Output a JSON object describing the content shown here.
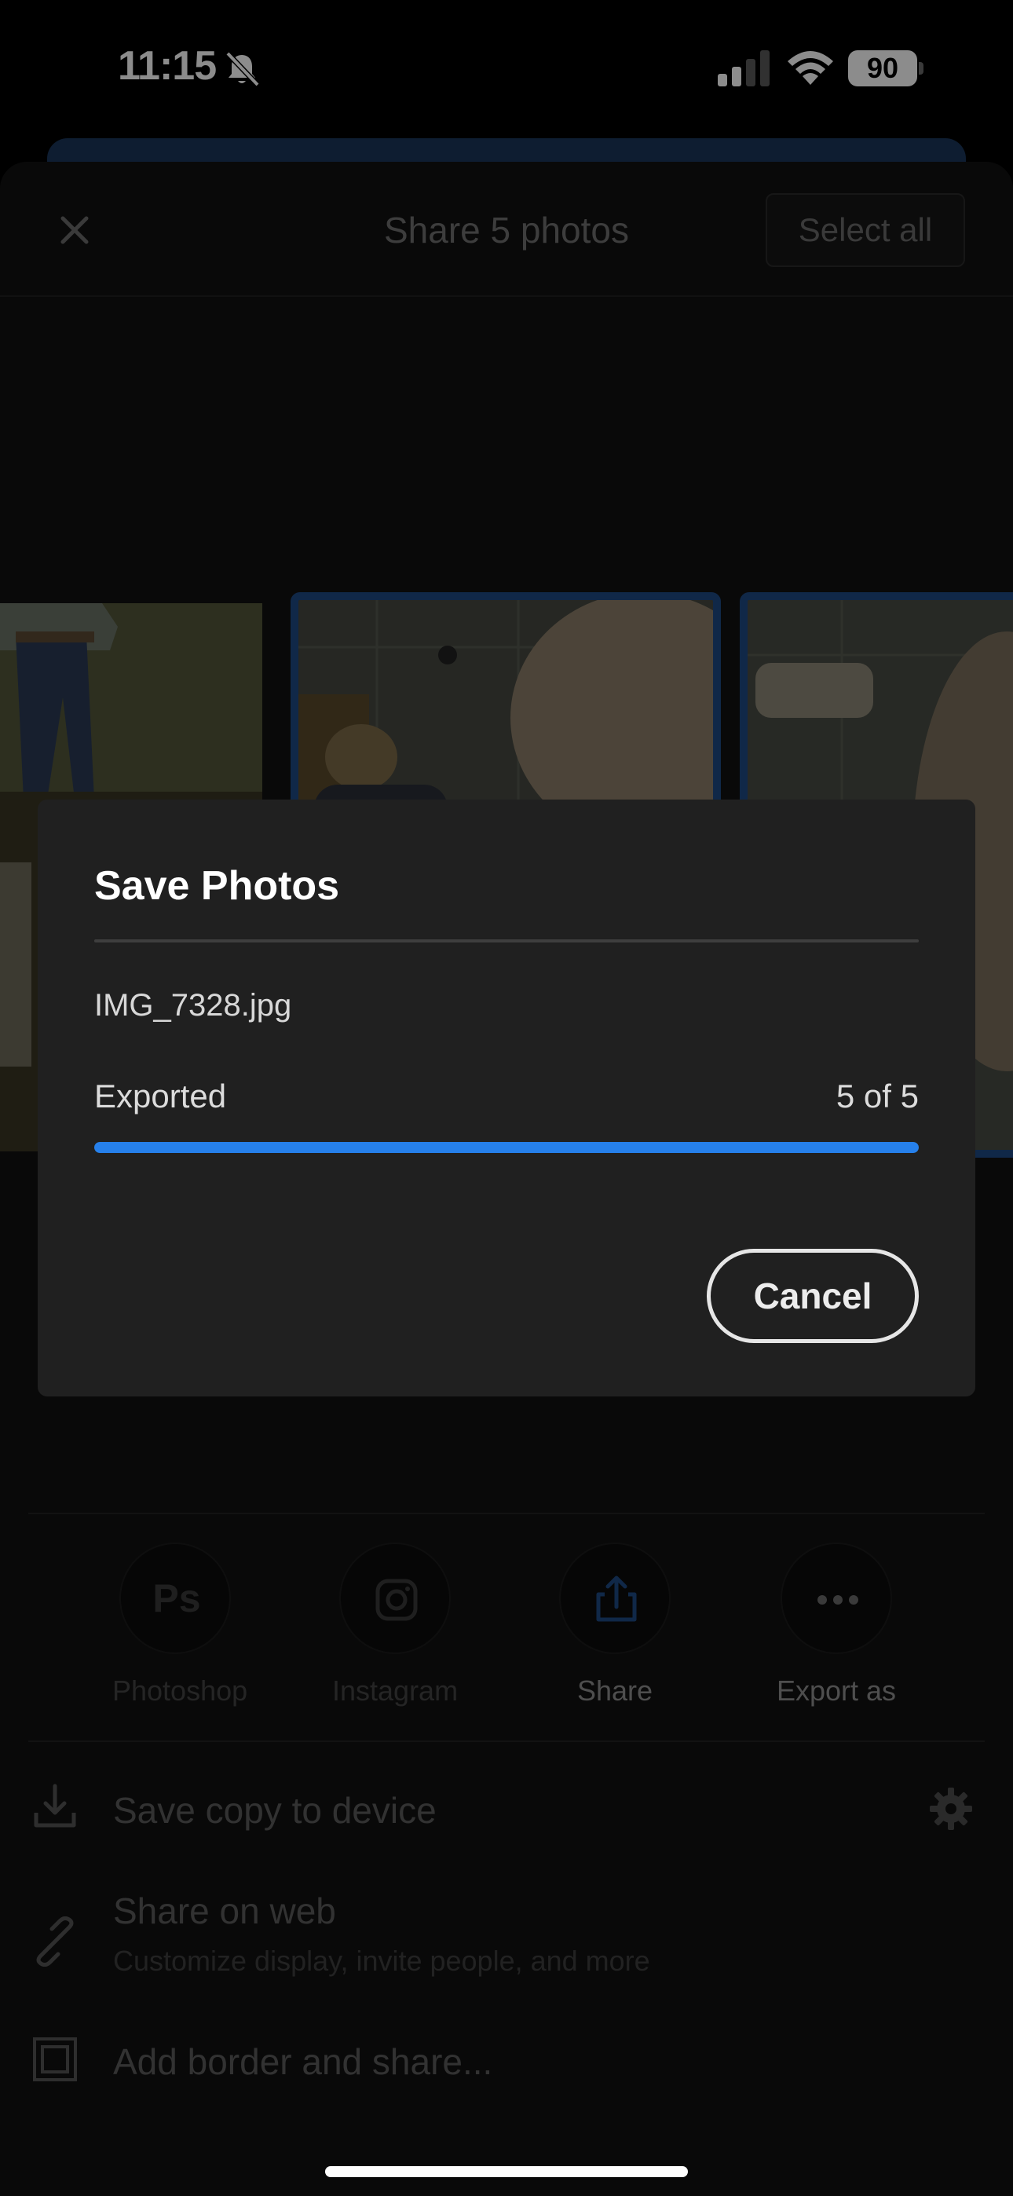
{
  "status_bar": {
    "time": "11:15",
    "battery": "90"
  },
  "sheet": {
    "title": "Share 5 photos",
    "select_all_label": "Select all"
  },
  "share_apps": [
    {
      "label": "Photoshop",
      "icon": "photoshop-icon"
    },
    {
      "label": "Instagram",
      "icon": "instagram-icon"
    },
    {
      "label": "Share",
      "icon": "share-icon"
    },
    {
      "label": "Export as",
      "icon": "more-icon"
    }
  ],
  "actions": {
    "save_copy": "Save copy to device",
    "share_web_title": "Share on web",
    "share_web_subtitle": "Customize display, invite people, and more",
    "add_border": "Add border and share..."
  },
  "modal": {
    "title": "Save Photos",
    "file_name": "IMG_7328.jpg",
    "progress_label": "Exported",
    "progress_count": "5 of 5",
    "progress_fraction": 1.0,
    "cancel_label": "Cancel"
  },
  "colors": {
    "accent": "#2680eb",
    "selection_border": "#1e4a83"
  }
}
